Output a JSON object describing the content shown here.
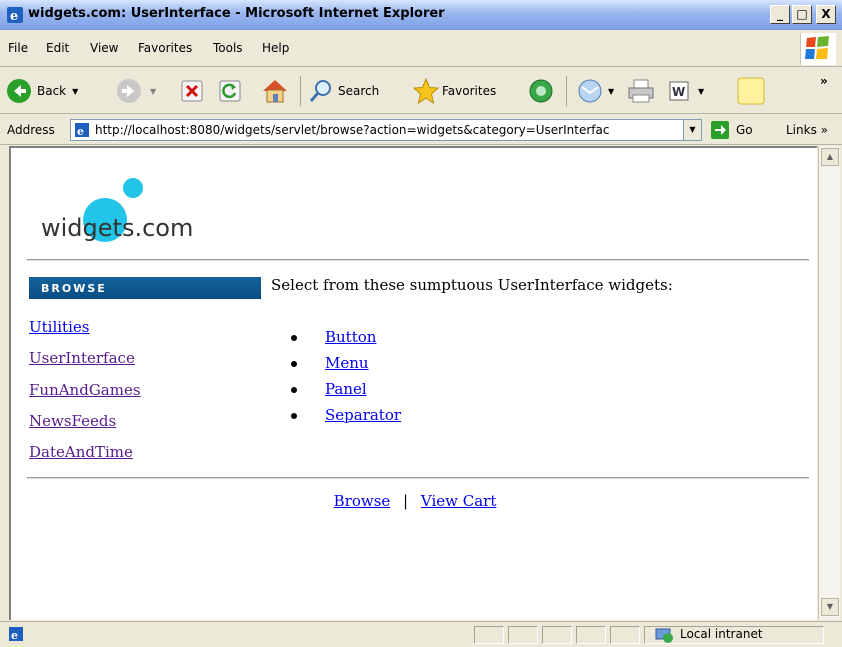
{
  "window": {
    "title": "widgets.com: UserInterface - Microsoft Internet Explorer",
    "min_label": "_",
    "max_label": "□",
    "close_label": "X"
  },
  "menu": {
    "items": [
      "File",
      "Edit",
      "View",
      "Favorites",
      "Tools",
      "Help"
    ]
  },
  "toolbar": {
    "back_label": "Back",
    "search_label": "Search",
    "favorites_label": "Favorites",
    "overflow_label": "»"
  },
  "address": {
    "label": "Address",
    "url": "http://localhost:8080/widgets/servlet/browse?action=widgets&category=UserInterfac",
    "go_label": "Go",
    "links_label": "Links »"
  },
  "page": {
    "logo_text": "widgets.com",
    "browse_header": "BROWSE",
    "categories": [
      "Utilities",
      "UserInterface",
      "FunAndGames",
      "NewsFeeds",
      "DateAndTime"
    ],
    "intro": "Select from these sumptuous UserInterface widgets:",
    "widgets": [
      "Button",
      "Menu",
      "Panel",
      "Separator"
    ],
    "footer": {
      "browse_label": "Browse",
      "separator": "|",
      "cart_label": "View Cart"
    }
  },
  "status": {
    "zone": "Local intranet"
  },
  "colors": {
    "browse_header_bg": "#0a4d86",
    "link_visited": "#551a8b",
    "link_unvisited": "#0000ee",
    "logo_dot": "#22c4e8"
  }
}
